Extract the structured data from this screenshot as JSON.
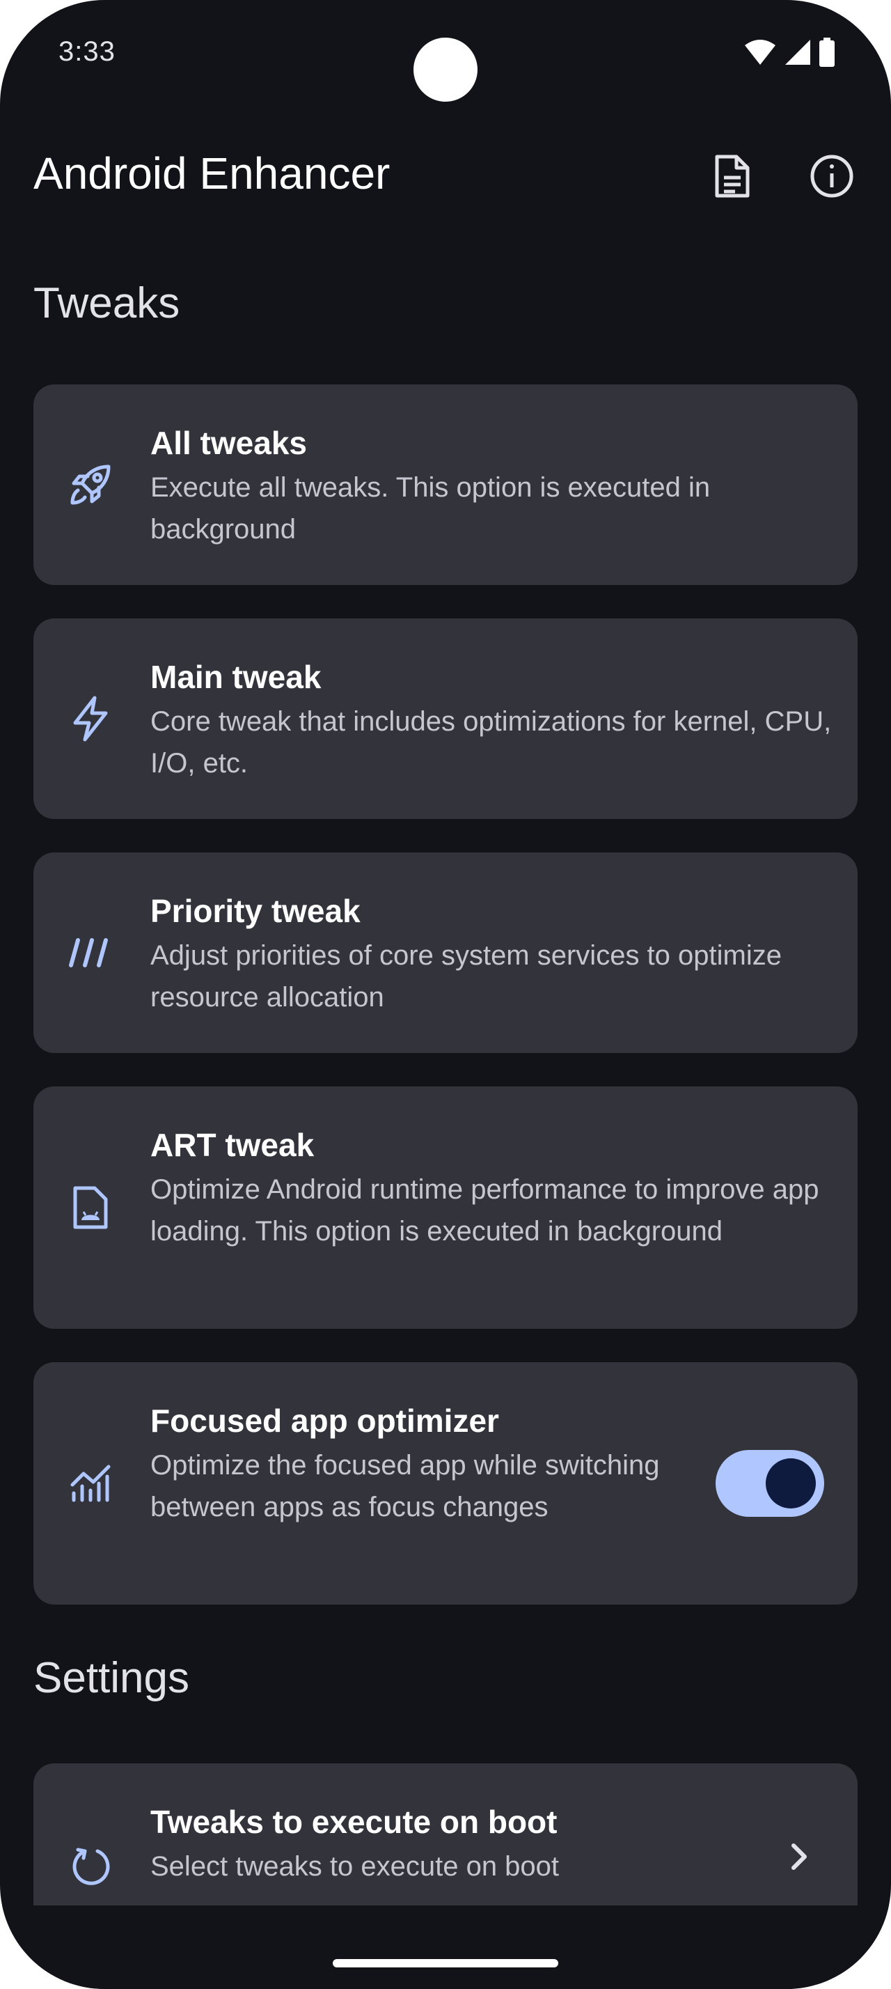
{
  "status_bar": {
    "time": "3:33",
    "icons": [
      "wifi-icon",
      "signal-icon",
      "battery-icon"
    ]
  },
  "app_bar": {
    "title": "Android Enhancer",
    "actions": [
      "log-document-icon",
      "info-icon"
    ]
  },
  "tweaks_section": {
    "title": "Tweaks",
    "cards": [
      {
        "icon": "rocket-icon",
        "title": "All tweaks",
        "description": "Execute all tweaks. This option is executed in background"
      },
      {
        "icon": "lightning-icon",
        "title": "Main tweak",
        "description": "Core tweak that includes optimizations for kernel, CPU, I/O, etc."
      },
      {
        "icon": "priority-lines-icon",
        "title": "Priority tweak",
        "description": "Adjust priorities of core system services to optimize resource allocation"
      },
      {
        "icon": "android-file-icon",
        "title": "ART tweak",
        "description": "Optimize Android runtime performance to improve app loading. This option is executed in background"
      },
      {
        "icon": "chart-trend-icon",
        "title": "Focused app optimizer",
        "description": "Optimize the focused app while switching between apps as focus changes",
        "toggle_on": true
      }
    ]
  },
  "settings_section": {
    "title": "Settings",
    "cards": [
      {
        "icon": "restart-icon",
        "title": "Tweaks to execute on boot",
        "description": "Select tweaks to execute on boot",
        "trailing_icon": "chevron-right-icon"
      }
    ]
  },
  "colors": {
    "background": "#121318",
    "card": "#33343b",
    "accent": "#b0c6ff",
    "title_text": "#ffffff",
    "body_text": "#c5c6d0"
  }
}
